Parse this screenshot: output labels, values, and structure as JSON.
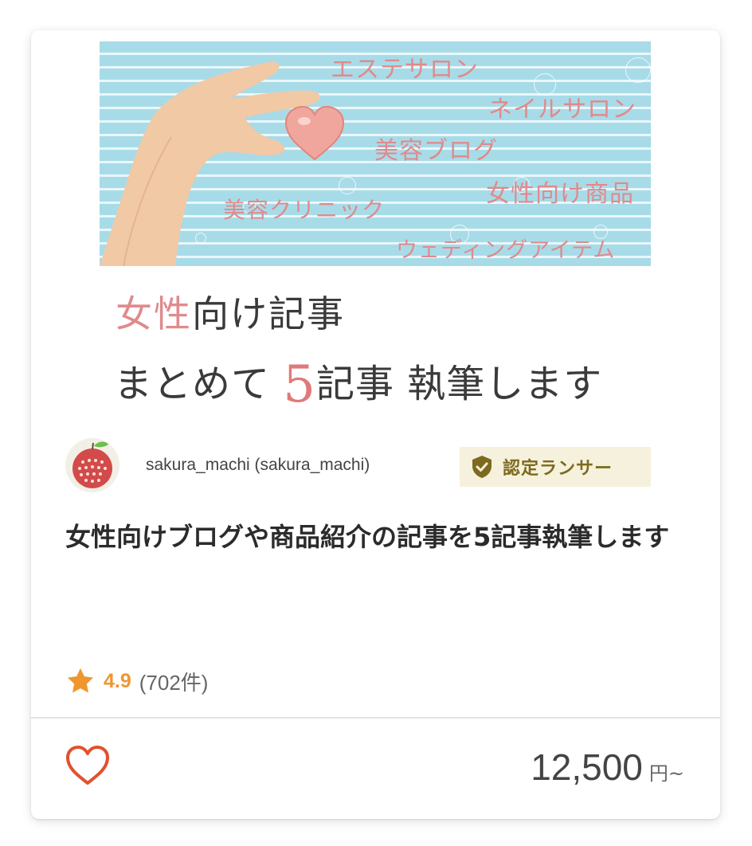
{
  "thumbnail": {
    "hero_labels": [
      "エステサロン",
      "ネイルサロン",
      "美容ブログ",
      "女性向け商品",
      "美容クリニック",
      "ウェディングアイテム"
    ],
    "headline_line1_accent": "女性",
    "headline_line1_rest": "向け記事",
    "headline_line2_a": "まとめて ",
    "headline_line2_num": "5",
    "headline_line2_b": "記事 執筆します"
  },
  "seller": {
    "name": "sakura_machi (sakura_machi)",
    "badge_label": "認定ランサー",
    "badge_icon": "shield-check-icon"
  },
  "service": {
    "title": "女性向けブログや商品紹介の記事を5記事執筆します"
  },
  "rating": {
    "icon": "star-icon",
    "score": "4.9",
    "count": "(702件)"
  },
  "footer": {
    "favorite_icon": "heart-outline-icon",
    "price": "12,500",
    "price_unit": "円~"
  },
  "colors": {
    "accent_pink": "#e08a8c",
    "rating_orange": "#f0962f",
    "badge_bg": "#f6f1dc",
    "badge_text": "#7d6a1f",
    "heart_red": "#e0522e"
  }
}
